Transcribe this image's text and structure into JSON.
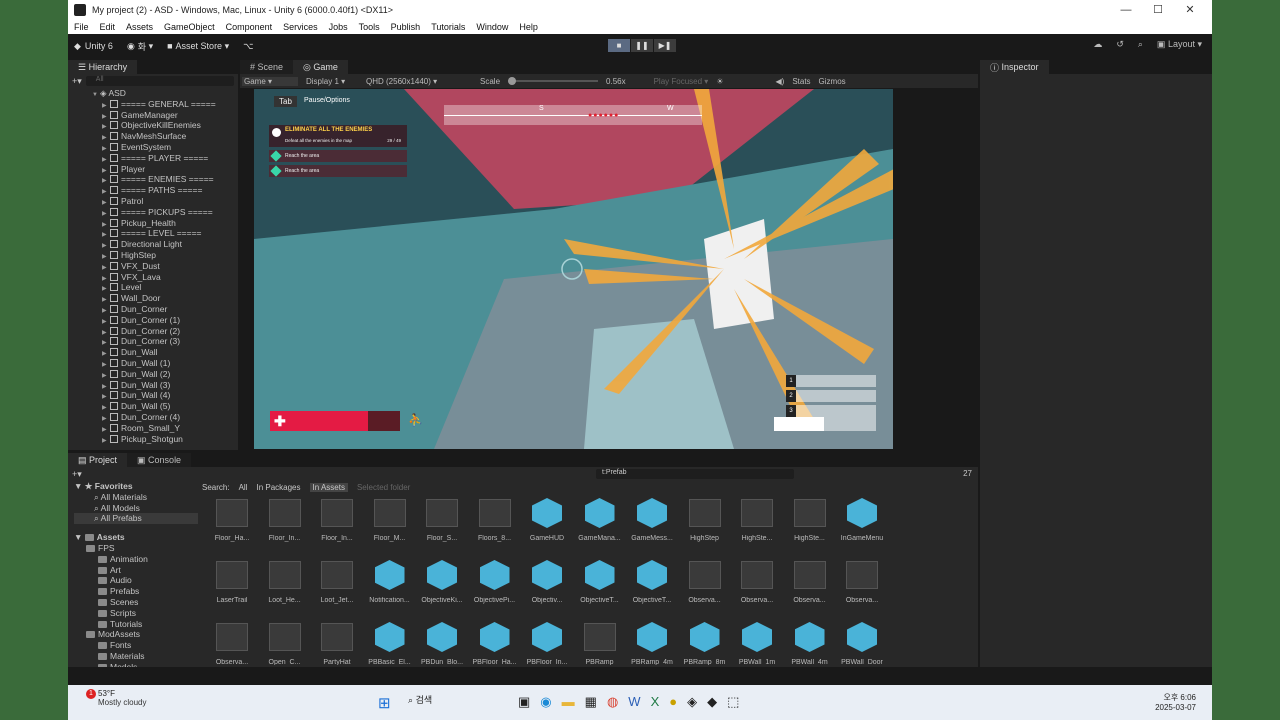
{
  "window": {
    "title": "My project (2) - ASD - Windows, Mac, Linux - Unity 6 (6000.0.40f1) <DX11>",
    "minimize": "—",
    "maximize": "☐",
    "close": "✕"
  },
  "menu": [
    "File",
    "Edit",
    "Assets",
    "GameObject",
    "Component",
    "Services",
    "Jobs",
    "Tools",
    "Publish",
    "Tutorials",
    "Window",
    "Help"
  ],
  "toolbar": {
    "unity_label": "Unity 6",
    "account": "화",
    "asset_store": "Asset Store",
    "layout": "Layout"
  },
  "hierarchy": {
    "tab": "Hierarchy",
    "search_placeholder": "All",
    "root": "ASD",
    "items": [
      "===== GENERAL =====",
      "GameManager",
      "ObjectiveKillEnemies",
      "NavMeshSurface",
      "EventSystem",
      "===== PLAYER =====",
      "Player",
      "===== ENEMIES =====",
      "===== PATHS =====",
      "Patrol",
      "===== PICKUPS =====",
      "Pickup_Health",
      "===== LEVEL =====",
      "Directional Light",
      "HighStep",
      "VFX_Dust",
      "VFX_Lava",
      "Level",
      "Wall_Door",
      "Dun_Corner",
      "Dun_Corner (1)",
      "Dun_Corner (2)",
      "Dun_Corner (3)",
      "Dun_Wall",
      "Dun_Wall (1)",
      "Dun_Wall (2)",
      "Dun_Wall (3)",
      "Dun_Wall (4)",
      "Dun_Wall (5)",
      "Dun_Corner (4)",
      "Room_Small_Y",
      "Pickup_Shotgun"
    ]
  },
  "scene_tabs": {
    "scene": "Scene",
    "game": "Game"
  },
  "game_toolbar": {
    "mode": "Game",
    "display": "Display 1",
    "resolution": "QHD (2560x1440)",
    "scale_label": "Scale",
    "scale_value": "0.56x",
    "play_focused": "Play Focused",
    "stats": "Stats",
    "gizmos": "Gizmos"
  },
  "hud": {
    "tab_key": "Tab",
    "pause_label": "Pause/Options",
    "objective_title": "ELIMINATE ALL THE ENEMIES",
    "objective_desc": "Defeat all the enemies in the map",
    "objective_count": "29 / 49",
    "reach_1": "Reach the area",
    "reach_2": "Reach the area",
    "compass_s": "S",
    "compass_w": "W",
    "weapon_slots": [
      "1",
      "2",
      "3"
    ],
    "health_fraction": 0.75
  },
  "inspector": {
    "tab": "Inspector"
  },
  "project": {
    "tab": "Project",
    "console_tab": "Console",
    "search_text": "t:Prefab",
    "count": "27",
    "search_label": "Search:",
    "filter_all": "All",
    "filter_packages": "In Packages",
    "filter_assets": "In Assets",
    "filter_folder": "Selected folder",
    "favorites_label": "Favorites",
    "favorites": [
      "All Materials",
      "All Models",
      "All Prefabs"
    ],
    "assets_label": "Assets",
    "tree": [
      "FPS",
      "Animation",
      "Art",
      "Audio",
      "Prefabs",
      "Scenes",
      "Scripts",
      "Tutorials",
      "ModAssets",
      "Fonts",
      "Materials",
      "Models"
    ],
    "grid": [
      [
        "Floor_Ha...",
        "Floor_In...",
        "Floor_In...",
        "Floor_M...",
        "Floor_S...",
        "Floors_8...",
        "GameHUD",
        "GameMana...",
        "GameMess...",
        "HighStep",
        "HighSte...",
        "HighSte...",
        "InGameMenu"
      ],
      [
        "LaserTrail",
        "Loot_He...",
        "Loot_Jet...",
        "Notification...",
        "ObjectiveKi...",
        "ObjectivePi...",
        "Objectiv...",
        "ObjectiveT...",
        "ObjectiveT...",
        "Observa...",
        "Observa...",
        "Observa...",
        "Observa..."
      ],
      [
        "Observa...",
        "Open_C...",
        "PartyHat",
        "PBBasic_El...",
        "PBDun_Blo...",
        "PBFloor_Ha...",
        "PBFloor_In...",
        "PBRamp",
        "PBRamp_4m",
        "PBRamp_8m",
        "PBWall_1m",
        "PBWall_4m",
        "PBWall_Door"
      ]
    ]
  },
  "taskbar": {
    "temp": "53°F",
    "weather": "Mostly cloudy",
    "search": "검색",
    "time": "오후 6:06",
    "date": "2025-03-07",
    "badge": "1"
  }
}
